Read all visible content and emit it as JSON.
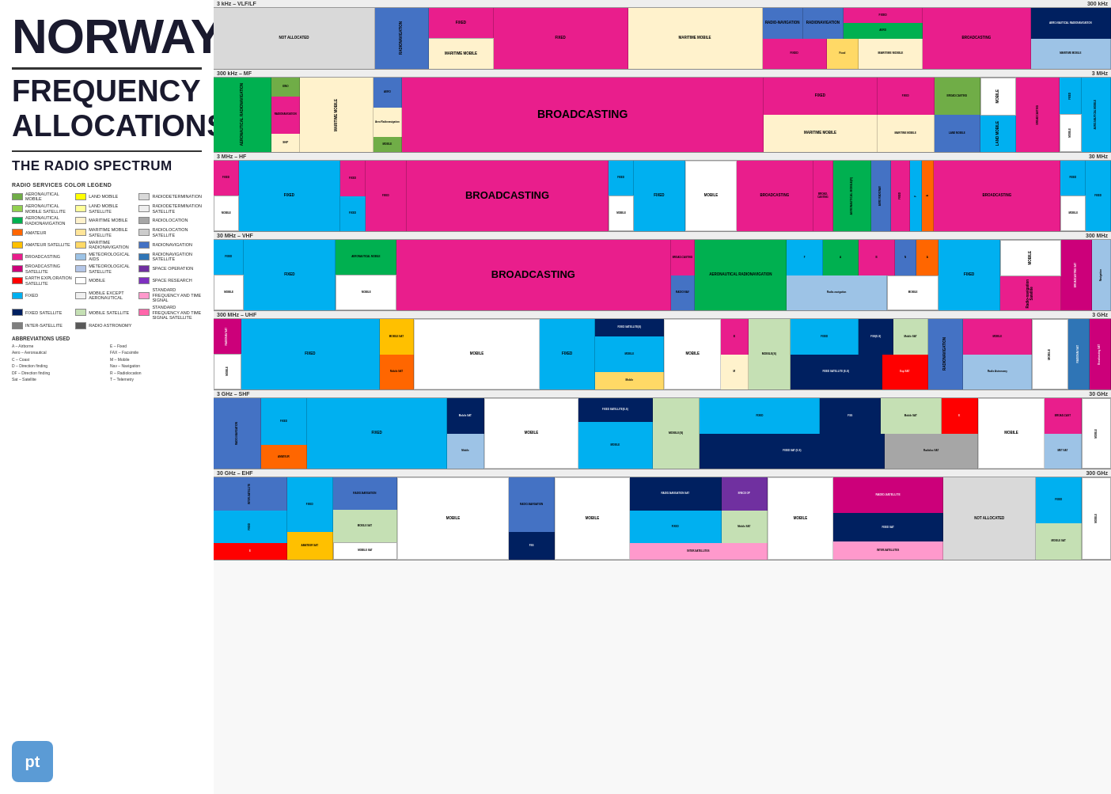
{
  "left": {
    "title_country": "NORWAY",
    "title_line1": "FREQUENCY",
    "title_line2": "ALLOCATIONS",
    "subtitle": "THE RADIO SPECTRUM",
    "legend_title": "RADIO SERVICES COLOR LEGEND",
    "legend_items": [
      {
        "label": "AERONAUTICAL MOBILE",
        "color": "#70ad47"
      },
      {
        "label": "LAND MOBILE",
        "color": "#ffff00"
      },
      {
        "label": "RADODETERMINATION",
        "color": "#d9d9d9"
      },
      {
        "label": "AERONAUTICAL MOBILE SATELLITE",
        "color": "#92d050"
      },
      {
        "label": "LAND MOBILE SATELLITE",
        "color": "#ffff99"
      },
      {
        "label": "RADIODETERMINATION SATELLITE",
        "color": "#eeeeee"
      },
      {
        "label": "AERONAUTICAL RADIONAVIGATION",
        "color": "#00b050"
      },
      {
        "label": "MARITIME MOBILE",
        "color": "#fff2cc"
      },
      {
        "label": "RADIOLOCATION",
        "color": "#a6a6a6"
      },
      {
        "label": "AMATEUR",
        "color": "#ff6600"
      },
      {
        "label": "MARITIME MOBILE SATELLITE",
        "color": "#ffe599"
      },
      {
        "label": "RADIOLOCATION SATELLITE",
        "color": "#cccccc"
      },
      {
        "label": "AMATEUR SATELLITE",
        "color": "#ffc000"
      },
      {
        "label": "MARITIME RADIONAVIGATION",
        "color": "#ffd966"
      },
      {
        "label": "RADIONAVIGATION",
        "color": "#4472c4"
      },
      {
        "label": "BROADCASTING",
        "color": "#e91e8c"
      },
      {
        "label": "METEOROLOGICAL AIDS",
        "color": "#9dc3e6"
      },
      {
        "label": "RADIONAVIGATION SATELLITE",
        "color": "#2f75b6"
      },
      {
        "label": "BROADCASTING SATELLITE",
        "color": "#cc007a"
      },
      {
        "label": "METEOROLOGICAL SATELLITE",
        "color": "#b4c6e7"
      },
      {
        "label": "SPACE OPERATION",
        "color": "#7030a0"
      },
      {
        "label": "EARTH EXPLORATION SATELLITE",
        "color": "#ff0000"
      },
      {
        "label": "MOBILE",
        "color": "#ffffff"
      },
      {
        "label": "SPACE RESEARCH",
        "color": "#6600cc"
      },
      {
        "label": "FIXED",
        "color": "#00b0f0"
      },
      {
        "label": "MOBILE EXCEPT AERONAUTICAL",
        "color": "#f8f8f8"
      },
      {
        "label": "STANDARD FREQUENCY AND TIME SIGNAL",
        "color": "#ff99cc"
      },
      {
        "label": "FIXED SATELLITE",
        "color": "#002060"
      },
      {
        "label": "MOBILE SATELLITE",
        "color": "#c5e0b4"
      },
      {
        "label": "STANDARD FREQUENCY AND TIME SIGNAL SATELLITE",
        "color": "#ff66aa"
      },
      {
        "label": "INTER-SATELLITE",
        "color": "#7f7f7f"
      },
      {
        "label": "RADIO ASTRONOMY",
        "color": "#595959"
      }
    ],
    "logo_text": "pt"
  },
  "bands": [
    {
      "label": "3 kHz – VLF/LF",
      "end_label": "300 kHz"
    },
    {
      "label": "300 kHz – MF",
      "end_label": "3 MHz"
    },
    {
      "label": "3 MHz – HF",
      "end_label": "30 MHz"
    },
    {
      "label": "30 MHz – VHF",
      "end_label": "300 MHz"
    },
    {
      "label": "300 MHz – UHF",
      "end_label": "3 GHz"
    },
    {
      "label": "3 GHz – SHF",
      "end_label": "30 GHz"
    },
    {
      "label": "30 GHz – EHF",
      "end_label": "300 GHz"
    }
  ]
}
